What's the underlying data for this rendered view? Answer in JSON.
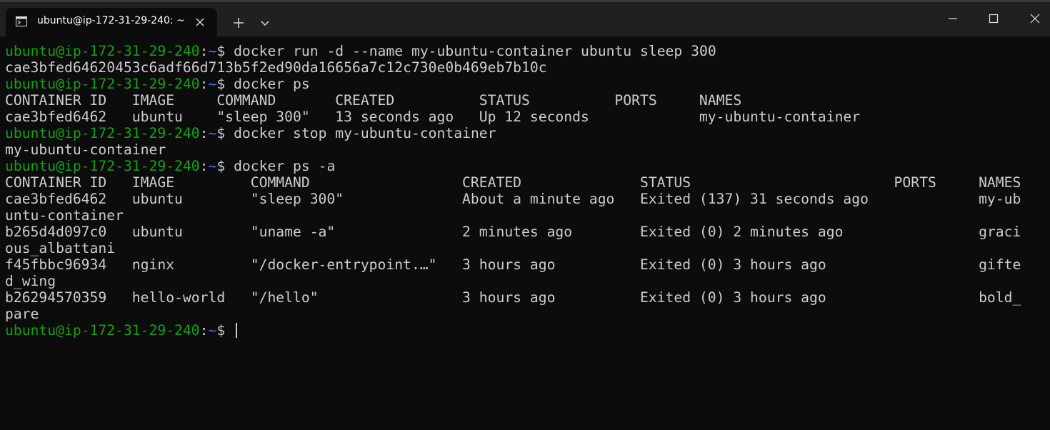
{
  "window": {
    "tab_title": "ubuntu@ip-172-31-29-240: ~",
    "icons": {
      "tab": "terminal-icon",
      "close_tab": "close-icon",
      "new_tab": "plus-icon",
      "dropdown": "chevron-down-icon",
      "minimize": "minimize-icon",
      "maximize": "maximize-icon",
      "close_window": "close-icon"
    }
  },
  "colors": {
    "background": "#0c0c0c",
    "titlebar": "#202020",
    "prompt_user": "#13a10e",
    "prompt_path": "#3b78ff",
    "text": "#cccccc"
  },
  "terminal": {
    "prompt": {
      "user_host": "ubuntu@ip-172-31-29-240",
      "separator": ":",
      "path": "~",
      "symbol": "$ "
    },
    "lines": [
      {
        "type": "cmd",
        "text": "docker run -d --name my-ubuntu-container ubuntu sleep 300"
      },
      {
        "type": "out",
        "text": "cae3bfed64620453c6adf66d713b5f2ed90da16656a7c12c730e0b469eb7b10c"
      },
      {
        "type": "cmd",
        "text": "docker ps"
      },
      {
        "type": "out",
        "text": "CONTAINER ID   IMAGE     COMMAND       CREATED          STATUS          PORTS     NAMES"
      },
      {
        "type": "out",
        "text": "cae3bfed6462   ubuntu    \"sleep 300\"   13 seconds ago   Up 12 seconds             my-ubuntu-container"
      },
      {
        "type": "cmd",
        "text": "docker stop my-ubuntu-container"
      },
      {
        "type": "out",
        "text": "my-ubuntu-container"
      },
      {
        "type": "cmd",
        "text": "docker ps -a"
      },
      {
        "type": "out",
        "text": "CONTAINER ID   IMAGE         COMMAND                  CREATED              STATUS                        PORTS     NAMES"
      },
      {
        "type": "out",
        "text": "cae3bfed6462   ubuntu        \"sleep 300\"              About a minute ago   Exited (137) 31 seconds ago             my-ub"
      },
      {
        "type": "out",
        "text": "untu-container"
      },
      {
        "type": "out",
        "text": "b265d4d097c0   ubuntu        \"uname -a\"               2 minutes ago        Exited (0) 2 minutes ago                graci"
      },
      {
        "type": "out",
        "text": "ous_albattani"
      },
      {
        "type": "out",
        "text": "f45fbbc96934   nginx         \"/docker-entrypoint.…\"   3 hours ago          Exited (0) 3 hours ago                  gifte"
      },
      {
        "type": "out",
        "text": "d_wing"
      },
      {
        "type": "out",
        "text": "b26294570359   hello-world   \"/hello\"                 3 hours ago          Exited (0) 3 hours ago                  bold_"
      },
      {
        "type": "out",
        "text": "pare"
      },
      {
        "type": "cmd",
        "text": ""
      }
    ]
  }
}
